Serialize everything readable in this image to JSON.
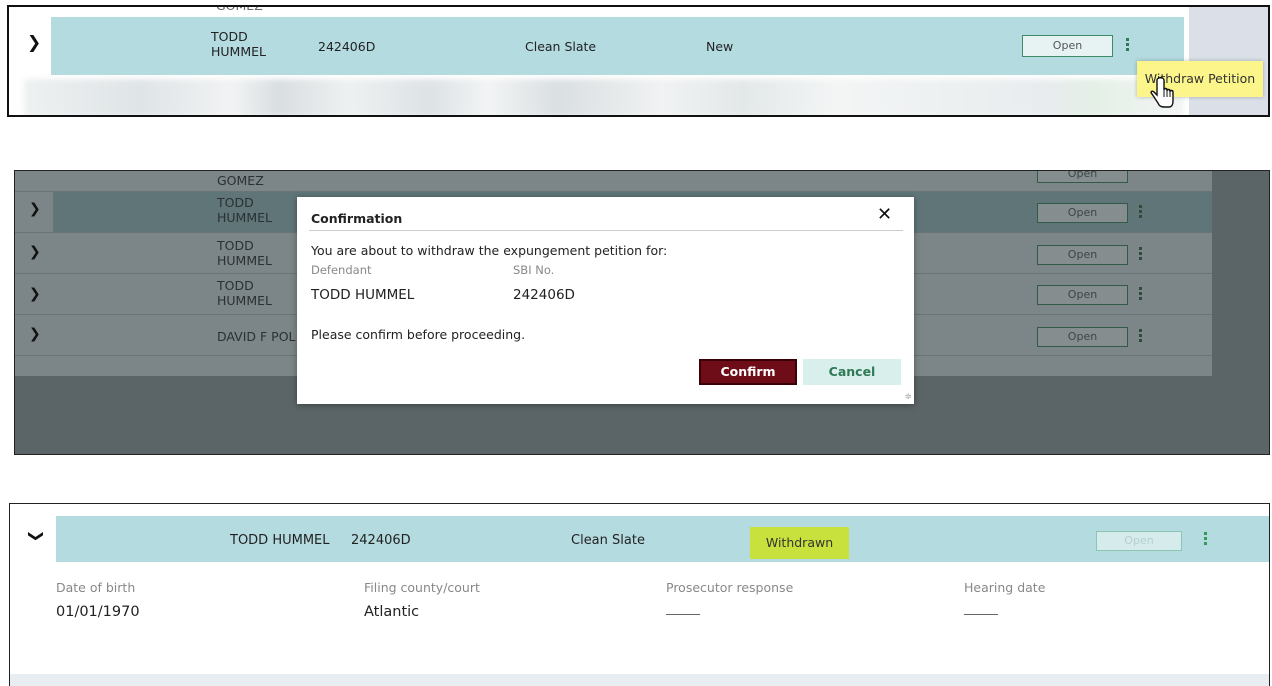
{
  "panel1": {
    "row": {
      "name": "TODD\nHUMMEL",
      "name_l1": "TODD",
      "name_l2": "HUMMEL",
      "sbi": "242406D",
      "type": "Clean Slate",
      "status": "New",
      "open_label": "Open"
    },
    "top_cutoff_text": "GOMEZ",
    "context_menu": {
      "item": "Withdraw Petition"
    }
  },
  "panel2": {
    "rows": [
      {
        "name_l1": "GOMEZ",
        "name_l2": "",
        "open_label": "Open"
      },
      {
        "name_l1": "TODD",
        "name_l2": "HUMMEL",
        "open_label": "Open"
      },
      {
        "name_l1": "TODD",
        "name_l2": "HUMMEL",
        "open_label": "Open"
      },
      {
        "name_l1": "TODD",
        "name_l2": "HUMMEL",
        "open_label": "Open"
      },
      {
        "name_l1": "DAVID F POL",
        "name_l2": "",
        "open_label": "Open"
      }
    ],
    "modal": {
      "title": "Confirmation",
      "message": "You are about to withdraw the expungement petition for:",
      "defendant_label": "Defendant",
      "defendant_value": "TODD HUMMEL",
      "sbi_label": "SBI No.",
      "sbi_value": "242406D",
      "prompt": "Please confirm before proceeding.",
      "confirm_label": "Confirm",
      "cancel_label": "Cancel"
    }
  },
  "panel3": {
    "row": {
      "name": "TODD HUMMEL",
      "sbi": "242406D",
      "type": "Clean Slate",
      "status": "Withdrawn",
      "open_label": "Open"
    },
    "details": [
      {
        "label": "Date of birth",
        "value": "01/01/1970"
      },
      {
        "label": "Filing county/court",
        "value": "Atlantic"
      },
      {
        "label": "Prosecutor response",
        "value": ""
      },
      {
        "label": "Hearing date",
        "value": ""
      }
    ]
  },
  "colors": {
    "row_band": "#b4dbe0",
    "confirm_bg": "#6e0c17",
    "status_withdrawn": "#c8e13c",
    "tooltip_bg": "#fbf58a"
  }
}
